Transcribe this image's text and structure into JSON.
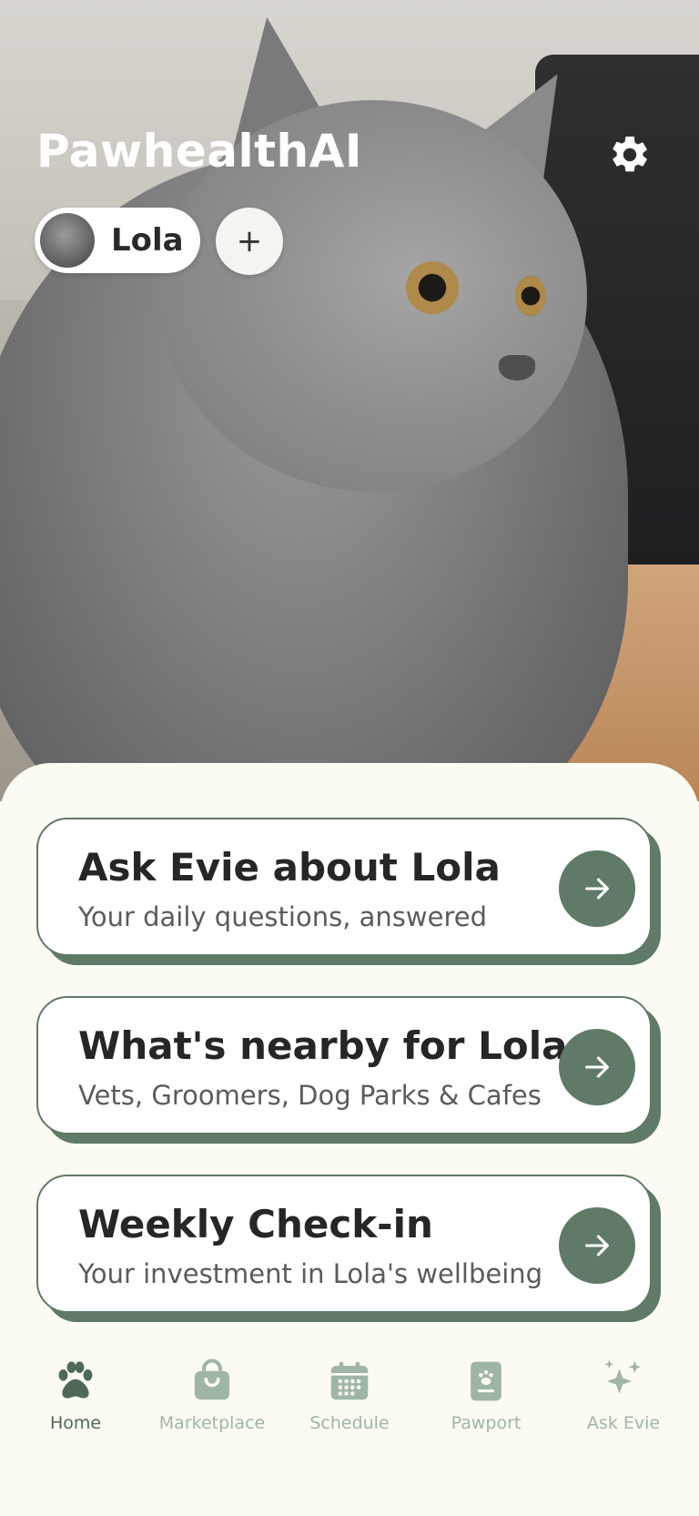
{
  "header": {
    "app_title": "PawhealthAI",
    "settings_icon": "gear-icon"
  },
  "pet_selector": {
    "selected_pet": "Lola",
    "add_label": "+"
  },
  "cards": [
    {
      "title": "Ask Evie about Lola",
      "subtitle": "Your daily questions, answered",
      "icon": "arrow-right-icon"
    },
    {
      "title": "What's nearby for Lola",
      "subtitle": "Vets, Groomers, Dog Parks & Cafes",
      "icon": "arrow-right-icon"
    },
    {
      "title": "Weekly Check-in",
      "subtitle": "Your investment in Lola's wellbeing",
      "icon": "arrow-right-icon"
    }
  ],
  "bottom_nav": [
    {
      "label": "Home",
      "icon": "paw-icon",
      "active": true
    },
    {
      "label": "Marketplace",
      "icon": "shopping-bag-icon",
      "active": false
    },
    {
      "label": "Schedule",
      "icon": "calendar-icon",
      "active": false
    },
    {
      "label": "Pawport",
      "icon": "passport-icon",
      "active": false
    },
    {
      "label": "Ask Evie",
      "icon": "sparkles-icon",
      "active": false
    }
  ],
  "colors": {
    "accent": "#5f7a66",
    "nav_active": "#4e6a57",
    "nav_inactive": "#9fb5a5",
    "background": "#fbfbf3"
  }
}
